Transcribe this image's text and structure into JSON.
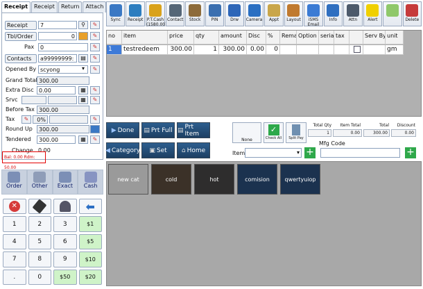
{
  "tabs": [
    "Receipt",
    "Receipt Info",
    "Return",
    "Attach"
  ],
  "left": {
    "receipt_label": "Receipt",
    "receipt_value": "7",
    "tbl_label": "Tbl/Order",
    "tbl_value": "0",
    "pax_label": "Pax",
    "pax_value": "0",
    "contacts_label": "Contacts",
    "contacts_value": "a99999999:",
    "opened_by_label": "Opened By",
    "opened_by_value": "scyong",
    "grand_total_label": "Grand Total",
    "grand_total_value": "300.00",
    "extra_disc_label": "Extra Disc",
    "extra_disc_value": "0.00",
    "srvc_label": "Srvc",
    "before_tax_label": "Before Tax",
    "before_tax_value": "300.00",
    "tax_label": "Tax",
    "tax_pct": "0%",
    "round_up_label": "Round Up",
    "round_up_value": "300.00",
    "tendered_label": "Tendered",
    "tendered_value": "300.00",
    "change_label": "Change",
    "change_value": "0.00",
    "balance_text": "Bal: 0.00 Rdm: 50.00"
  },
  "actions": [
    "Order",
    "Other",
    "Exact",
    "Cash"
  ],
  "keypad": [
    "1",
    "2",
    "3",
    "$1",
    "4",
    "5",
    "6",
    "$5",
    "7",
    "8",
    "9",
    "$10",
    ".",
    "0",
    "$50",
    "$20"
  ],
  "toolbar": [
    {
      "label": "Sync",
      "icon": "sync-icon",
      "color": "#3a78c4"
    },
    {
      "label": "Receipt",
      "icon": "receipt-icon",
      "color": "#2c7dbf"
    },
    {
      "label": "P.T.Cash (1580.00)",
      "icon": "key-icon",
      "color": "#d9a21b"
    },
    {
      "label": "Contact",
      "icon": "contact-icon",
      "color": "#556677"
    },
    {
      "label": "Stock",
      "icon": "stock-icon",
      "color": "#8d6b3a"
    },
    {
      "label": "PIN",
      "icon": "pin-icon",
      "color": "#3a6fb0"
    },
    {
      "label": "Drw",
      "icon": "drawer-icon",
      "color": "#2d66b8"
    },
    {
      "label": "Camera",
      "icon": "camera-icon",
      "color": "#2a6fc2"
    },
    {
      "label": "Appt",
      "icon": "appointment-icon",
      "color": "#c9a64a"
    },
    {
      "label": "Layout",
      "icon": "layout-icon",
      "color": "#c07a2f"
    },
    {
      "label": "iSMS Email",
      "icon": "email-icon",
      "color": "#3b7bd4"
    },
    {
      "label": "Info",
      "icon": "info-icon",
      "color": "#2f6fc0"
    },
    {
      "label": "Attn",
      "icon": "attention-icon",
      "color": "#4d5a6b"
    },
    {
      "label": "Alert",
      "icon": "alert-icon",
      "color": "#f0d000"
    },
    {
      "label": "",
      "icon": "new-icon",
      "color": "#8fc86a"
    },
    {
      "label": "Delete",
      "icon": "delete-icon",
      "color": "#c63b3b"
    }
  ],
  "grid": {
    "headers": [
      "no",
      "item",
      "price",
      "qty",
      "amount",
      "Disc",
      "%",
      "Rema",
      "Option",
      "seria",
      "tax",
      "",
      "Serv By",
      "unit"
    ],
    "row": [
      "1",
      "testredeem",
      "300.00",
      "1",
      "300.00",
      "0.00",
      "0",
      "",
      "",
      "",
      "",
      "",
      "",
      "gm"
    ]
  },
  "buttons": {
    "done": "Done",
    "prt_full": "Prt Full",
    "prt_item": "Prt Item",
    "category": "Category",
    "set": "Set",
    "home": "Home",
    "none": "None",
    "check_all": "Check All",
    "split_pay": "Split Pay"
  },
  "totals": {
    "qty_label": "Total Qty",
    "qty_value": "1",
    "item_total_label": "Item Total",
    "item_total_value": "0.00",
    "total_label": "Total",
    "total_value": "300.00",
    "discount_label": "Discount",
    "discount_value": "0.00"
  },
  "mfg_code_label": "Mfg Code",
  "item_label": "Item",
  "categories": [
    {
      "label": "new cat",
      "color": "#9a9a9a"
    },
    {
      "label": "cold",
      "color": "#3b3128"
    },
    {
      "label": "hot",
      "color": "#2e2d2d"
    },
    {
      "label": "comision",
      "color": "#1b324f"
    },
    {
      "label": "qwertyuiop",
      "color": "#1b324f"
    }
  ]
}
